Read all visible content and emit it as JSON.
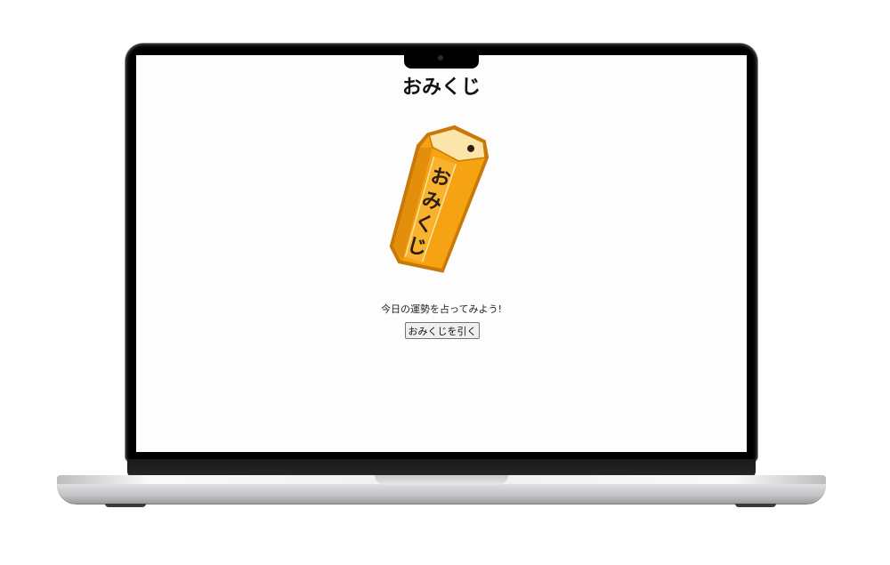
{
  "page": {
    "title": "おみくじ",
    "prompt": "今日の運勢を占ってみよう!",
    "draw_button_label": "おみくじを引く"
  },
  "illustration": {
    "name": "omikuji-box",
    "label_text": "おみくじ",
    "colors": {
      "body": "#f5a313",
      "body_dark": "#d9830a",
      "top": "#fde4a8",
      "outline": "#c8790a",
      "ink": "#2b1d14"
    }
  },
  "device": {
    "type": "laptop",
    "colors": {
      "bezel": "#000000",
      "base": "#d6d6d8",
      "screen_bg": "#fdfdfd"
    }
  }
}
